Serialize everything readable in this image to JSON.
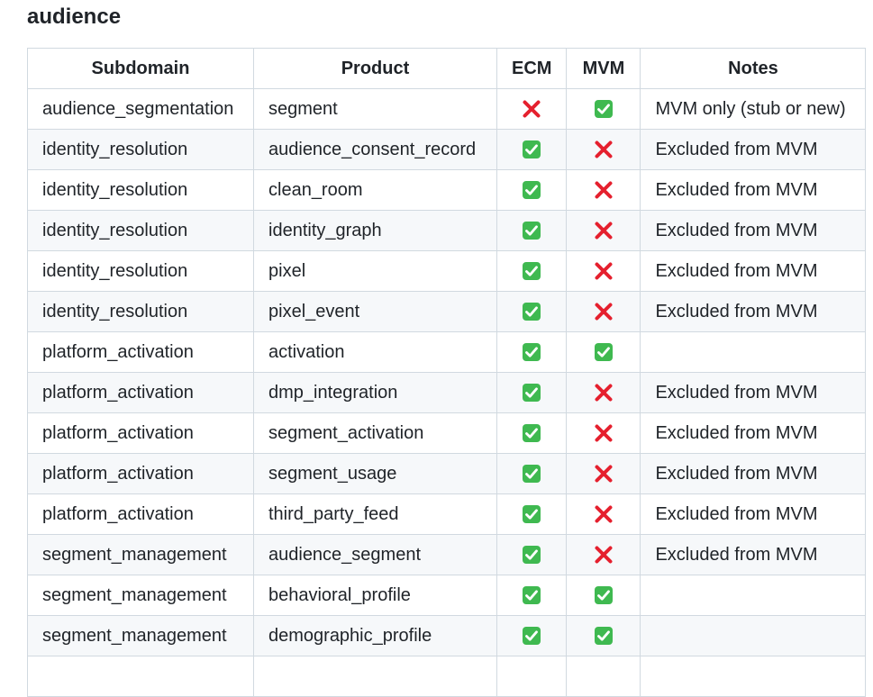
{
  "section": {
    "title": "audience"
  },
  "table": {
    "headers": [
      "Subdomain",
      "Product",
      "ECM",
      "MVM",
      "Notes"
    ],
    "rows": [
      {
        "subdomain": "audience_segmentation",
        "product": "segment",
        "ecm": "cross-mark-icon",
        "mvm": "check-mark-button-icon",
        "notes": "MVM only (stub or new)"
      },
      {
        "subdomain": "identity_resolution",
        "product": "audience_consent_record",
        "ecm": "check-mark-button-icon",
        "mvm": "cross-mark-icon",
        "notes": "Excluded from MVM"
      },
      {
        "subdomain": "identity_resolution",
        "product": "clean_room",
        "ecm": "check-mark-button-icon",
        "mvm": "cross-mark-icon",
        "notes": "Excluded from MVM"
      },
      {
        "subdomain": "identity_resolution",
        "product": "identity_graph",
        "ecm": "check-mark-button-icon",
        "mvm": "cross-mark-icon",
        "notes": "Excluded from MVM"
      },
      {
        "subdomain": "identity_resolution",
        "product": "pixel",
        "ecm": "check-mark-button-icon",
        "mvm": "cross-mark-icon",
        "notes": "Excluded from MVM"
      },
      {
        "subdomain": "identity_resolution",
        "product": "pixel_event",
        "ecm": "check-mark-button-icon",
        "mvm": "cross-mark-icon",
        "notes": "Excluded from MVM"
      },
      {
        "subdomain": "platform_activation",
        "product": "activation",
        "ecm": "check-mark-button-icon",
        "mvm": "check-mark-button-icon",
        "notes": ""
      },
      {
        "subdomain": "platform_activation",
        "product": "dmp_integration",
        "ecm": "check-mark-button-icon",
        "mvm": "cross-mark-icon",
        "notes": "Excluded from MVM"
      },
      {
        "subdomain": "platform_activation",
        "product": "segment_activation",
        "ecm": "check-mark-button-icon",
        "mvm": "cross-mark-icon",
        "notes": "Excluded from MVM"
      },
      {
        "subdomain": "platform_activation",
        "product": "segment_usage",
        "ecm": "check-mark-button-icon",
        "mvm": "cross-mark-icon",
        "notes": "Excluded from MVM"
      },
      {
        "subdomain": "platform_activation",
        "product": "third_party_feed",
        "ecm": "check-mark-button-icon",
        "mvm": "cross-mark-icon",
        "notes": "Excluded from MVM"
      },
      {
        "subdomain": "segment_management",
        "product": "audience_segment",
        "ecm": "check-mark-button-icon",
        "mvm": "cross-mark-icon",
        "notes": "Excluded from MVM"
      },
      {
        "subdomain": "segment_management",
        "product": "behavioral_profile",
        "ecm": "check-mark-button-icon",
        "mvm": "check-mark-button-icon",
        "notes": ""
      },
      {
        "subdomain": "segment_management",
        "product": "demographic_profile",
        "ecm": "check-mark-button-icon",
        "mvm": "check-mark-button-icon",
        "notes": ""
      },
      {
        "subdomain": "",
        "product": "",
        "ecm": "",
        "mvm": "",
        "notes": ""
      }
    ]
  },
  "colors": {
    "check_green": "#3fb950",
    "cross_red": "#e5202e",
    "row_stripe": "#f6f8fa",
    "border": "#d1d9e0",
    "text": "#1f2328"
  }
}
